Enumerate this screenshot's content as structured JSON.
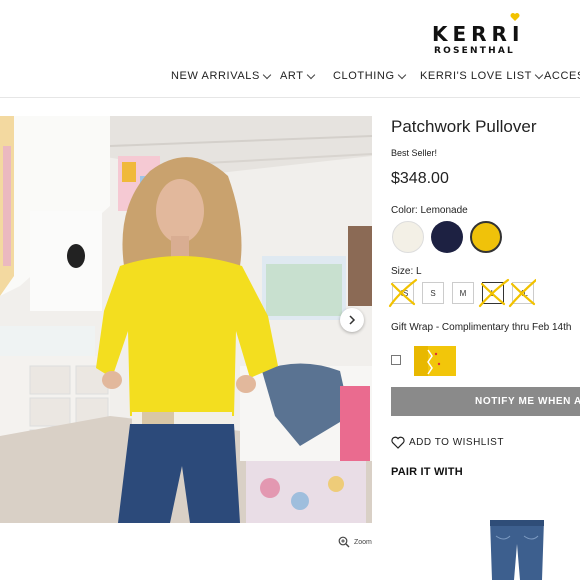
{
  "brand": {
    "line1": "KERRI",
    "line2": "ROSENTHAL",
    "accent": "#f2c200"
  },
  "nav": [
    {
      "label": "NEW ARRIVALS"
    },
    {
      "label": "ART"
    },
    {
      "label": "CLOTHING"
    },
    {
      "label": "KERRI'S LOVE LIST"
    },
    {
      "label": "ACCES"
    }
  ],
  "gallery": {
    "zoom_label": "Zoom"
  },
  "product": {
    "title": "Patchwork Pullover",
    "badge": "Best Seller!",
    "price": "$348.00",
    "color_label": "Color: Lemonade",
    "colors": [
      {
        "name": "cream",
        "hex": "#f3f0e6"
      },
      {
        "name": "navy",
        "hex": "#1d2142"
      },
      {
        "name": "lemonade",
        "hex": "#f0c20a"
      }
    ],
    "size_label": "Size: L",
    "sizes": [
      {
        "label": "XS",
        "available": false
      },
      {
        "label": "S",
        "available": true
      },
      {
        "label": "M",
        "available": true
      },
      {
        "label": "L",
        "available": false
      },
      {
        "label": "XL",
        "available": false
      }
    ],
    "gift_wrap_label": "Gift Wrap - Complimentary thru Feb 14th",
    "notify_label": "NOTIFY ME WHEN A",
    "wishlist_label": "ADD TO WISHLIST",
    "pair_label": "PAIR IT WITH"
  }
}
